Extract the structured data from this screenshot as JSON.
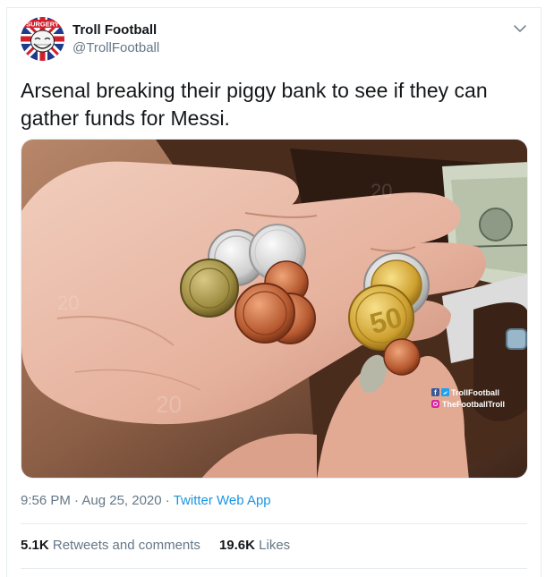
{
  "tweet": {
    "author_name": "Troll Football",
    "author_handle": "@TrollFootball",
    "avatar_text": "SURGERY",
    "text": "Arsenal breaking their piggy bank to see if they can gather funds for Messi.",
    "time": "9:56 PM · Aug 25, 2020",
    "separator": " · ",
    "source_app": "Twitter Web App",
    "retweets_count": "5.1K",
    "retweets_label": "Retweets and comments",
    "likes_count": "19.6K",
    "likes_label": "Likes"
  },
  "media": {
    "watermark_line1": "TrollFootball",
    "watermark_line2": "TheFootballTroll",
    "coin_label": "50"
  },
  "icons": {
    "menu": "chevron-down-icon",
    "facebook": "facebook-icon",
    "twitter": "twitter-icon",
    "instagram": "instagram-icon"
  },
  "colors": {
    "link": "#1b95e0",
    "secondary_text": "#657786",
    "primary_text": "#14171a",
    "divider": "#e6ecf0"
  }
}
